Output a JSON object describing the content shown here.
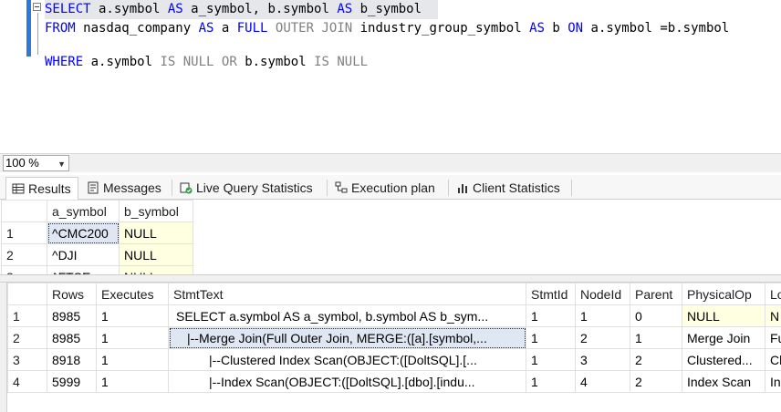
{
  "editor": {
    "lines": [
      [
        {
          "t": "SELECT",
          "c": "kw"
        },
        {
          "t": " a.symbol "
        },
        {
          "t": "AS",
          "c": "kw"
        },
        {
          "t": " a_symbol, b.symbol "
        },
        {
          "t": "AS",
          "c": "kw"
        },
        {
          "t": " b_symbol"
        }
      ],
      [
        {
          "t": "FROM",
          "c": "kw"
        },
        {
          "t": " nasdaq_company "
        },
        {
          "t": "AS",
          "c": "kw"
        },
        {
          "t": " a "
        },
        {
          "t": "FULL",
          "c": "kw"
        },
        {
          "t": " "
        },
        {
          "t": "OUTER",
          "c": "gr"
        },
        {
          "t": " "
        },
        {
          "t": "JOIN",
          "c": "gr"
        },
        {
          "t": " industry_group_symbol "
        },
        {
          "t": "AS",
          "c": "kw"
        },
        {
          "t": " b "
        },
        {
          "t": "ON",
          "c": "kw"
        },
        {
          "t": " a.symbol =b.symbol"
        }
      ],
      [
        {
          "t": "WHERE",
          "c": "kw"
        },
        {
          "t": " a.symbol "
        },
        {
          "t": "IS",
          "c": "gr"
        },
        {
          "t": " "
        },
        {
          "t": "NULL",
          "c": "gr"
        },
        {
          "t": " "
        },
        {
          "t": "OR",
          "c": "gr"
        },
        {
          "t": " b.symbol "
        },
        {
          "t": "IS",
          "c": "gr"
        },
        {
          "t": " "
        },
        {
          "t": "NULL",
          "c": "gr"
        }
      ]
    ]
  },
  "zoom": {
    "value": "100 %"
  },
  "tabs": [
    {
      "label": "Results",
      "icon": "grid-icon"
    },
    {
      "label": "Messages",
      "icon": "messages-icon"
    },
    {
      "label": "Live Query Statistics",
      "icon": "live-stats-icon"
    },
    {
      "label": "Execution plan",
      "icon": "execution-plan-icon"
    },
    {
      "label": "Client Statistics",
      "icon": "client-stats-icon"
    }
  ],
  "results1": {
    "columns": [
      "a_symbol",
      "b_symbol"
    ],
    "rows": [
      [
        "1",
        "^CMC200",
        "NULL"
      ],
      [
        "2",
        "^DJI",
        "NULL"
      ],
      [
        "3",
        "^FTSE",
        "NULL"
      ]
    ]
  },
  "results2": {
    "columns": [
      "Rows",
      "Executes",
      "StmtText",
      "StmtId",
      "NodeId",
      "Parent",
      "PhysicalOp",
      "LogicalOp"
    ],
    "rows": [
      [
        "1",
        "8985",
        "1",
        "SELECT a.symbol AS a_symbol, b.symbol AS b_sym...",
        "1",
        "1",
        "0",
        "NULL",
        "NULL"
      ],
      [
        "2",
        "8985",
        "1",
        "|--Merge Join(Full Outer Join, MERGE:([a].[symbol,...",
        "1",
        "2",
        "1",
        "Merge Join",
        "Full Outer Join"
      ],
      [
        "3",
        "8918",
        "1",
        "|--Clustered Index Scan(OBJECT:([DoltSQL].[...",
        "1",
        "3",
        "2",
        "Clustered...",
        "Clustered Index Scan"
      ],
      [
        "4",
        "5999",
        "1",
        "|--Index Scan(OBJECT:([DoltSQL].[dbo].[indu...",
        "1",
        "4",
        "2",
        "Index Scan",
        "Index Scan"
      ]
    ]
  },
  "colors": {
    "keyword": "#0000ff",
    "gray": "#808080",
    "null_bg": "#ffffe1",
    "accent": "#2b79d8"
  }
}
